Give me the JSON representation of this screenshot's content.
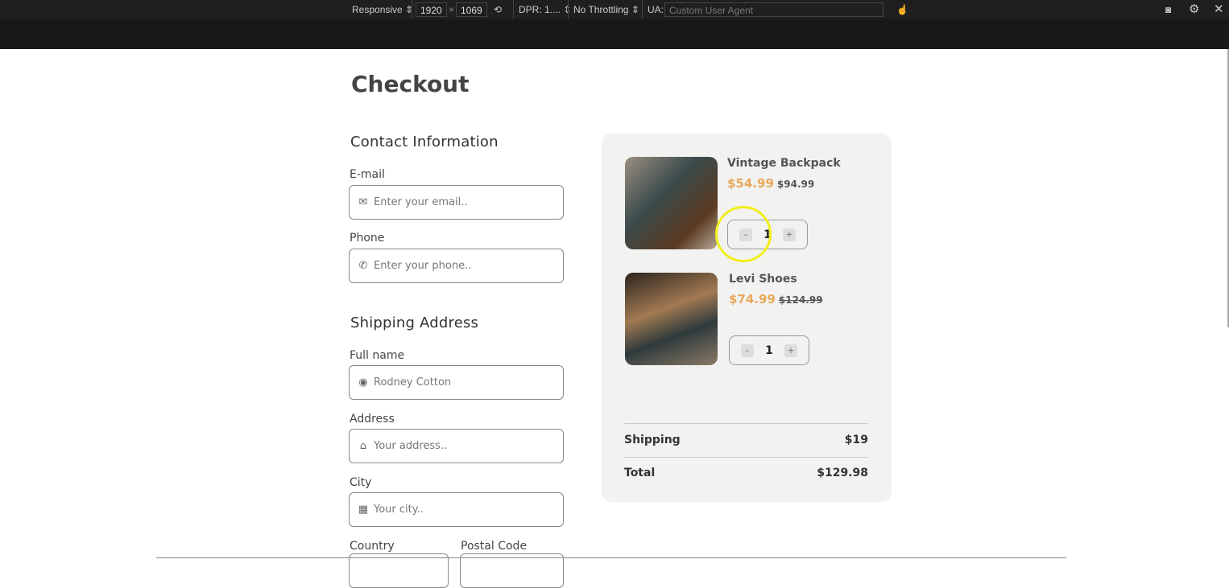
{
  "devtools": {
    "device": "Responsive",
    "width": "1920",
    "x": "×",
    "height": "1069",
    "dpr": "DPR: 1....",
    "throttling": "No Throttling",
    "ua_label": "UA:",
    "ua_placeholder": "Custom User Agent"
  },
  "page": {
    "title": "Checkout"
  },
  "contact": {
    "heading": "Contact Information",
    "email_label": "E-mail",
    "email_placeholder": "Enter your email..",
    "phone_label": "Phone",
    "phone_placeholder": "Enter your phone.."
  },
  "shipping": {
    "heading": "Shipping Address",
    "name_label": "Full name",
    "name_value": "Rodney Cotton",
    "address_label": "Address",
    "address_placeholder": "Your address..",
    "city_label": "City",
    "city_placeholder": "Your city..",
    "country_label": "Country",
    "postal_label": "Postal Code"
  },
  "cart": {
    "items": [
      {
        "name": "Vintage Backpack",
        "price": "$54.99",
        "old_price": "$94.99",
        "qty": "1"
      },
      {
        "name": "Levi Shoes",
        "price": "$74.99",
        "old_price": "$124.99",
        "qty": "1"
      }
    ],
    "shipping_label": "Shipping",
    "shipping_value": "$19",
    "total_label": "Total",
    "total_value": "$129.98",
    "minus": "–",
    "plus": "+"
  },
  "colors": {
    "accent": "#e8a85a",
    "summary_bg": "#f2f2f1"
  }
}
